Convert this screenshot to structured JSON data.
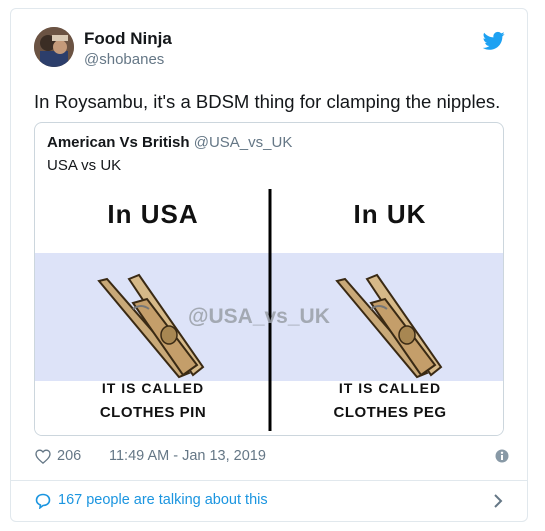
{
  "colors": {
    "twitter_blue": "#1da1f2",
    "link_blue": "#1b95e0",
    "muted_gray": "#657786",
    "meme_band": "#dde3f8"
  },
  "author": {
    "name": "Food Ninja",
    "handle": "@shobanes"
  },
  "tweet": {
    "text": "In Roysambu, it's a BDSM thing for clamping the nipples."
  },
  "quote": {
    "name": "American Vs British",
    "handle": "@USA_vs_UK",
    "text": "USA vs UK",
    "meme": {
      "left_title": "In USA",
      "right_title": "In UK",
      "left_called": "IT IS CALLED",
      "right_called": "IT IS CALLED",
      "left_name": "CLOTHES PIN",
      "right_name": "CLOTHES PEG",
      "watermark": "@USA_vs_UK"
    }
  },
  "actions": {
    "likes": "206",
    "timestamp": "11:49 AM - Jan 13, 2019"
  },
  "conversation": {
    "text": "167 people are talking about this"
  },
  "icons": [
    "twitter-bird-icon",
    "heart-icon",
    "info-icon",
    "speech-bubble-icon",
    "chevron-right-icon"
  ]
}
